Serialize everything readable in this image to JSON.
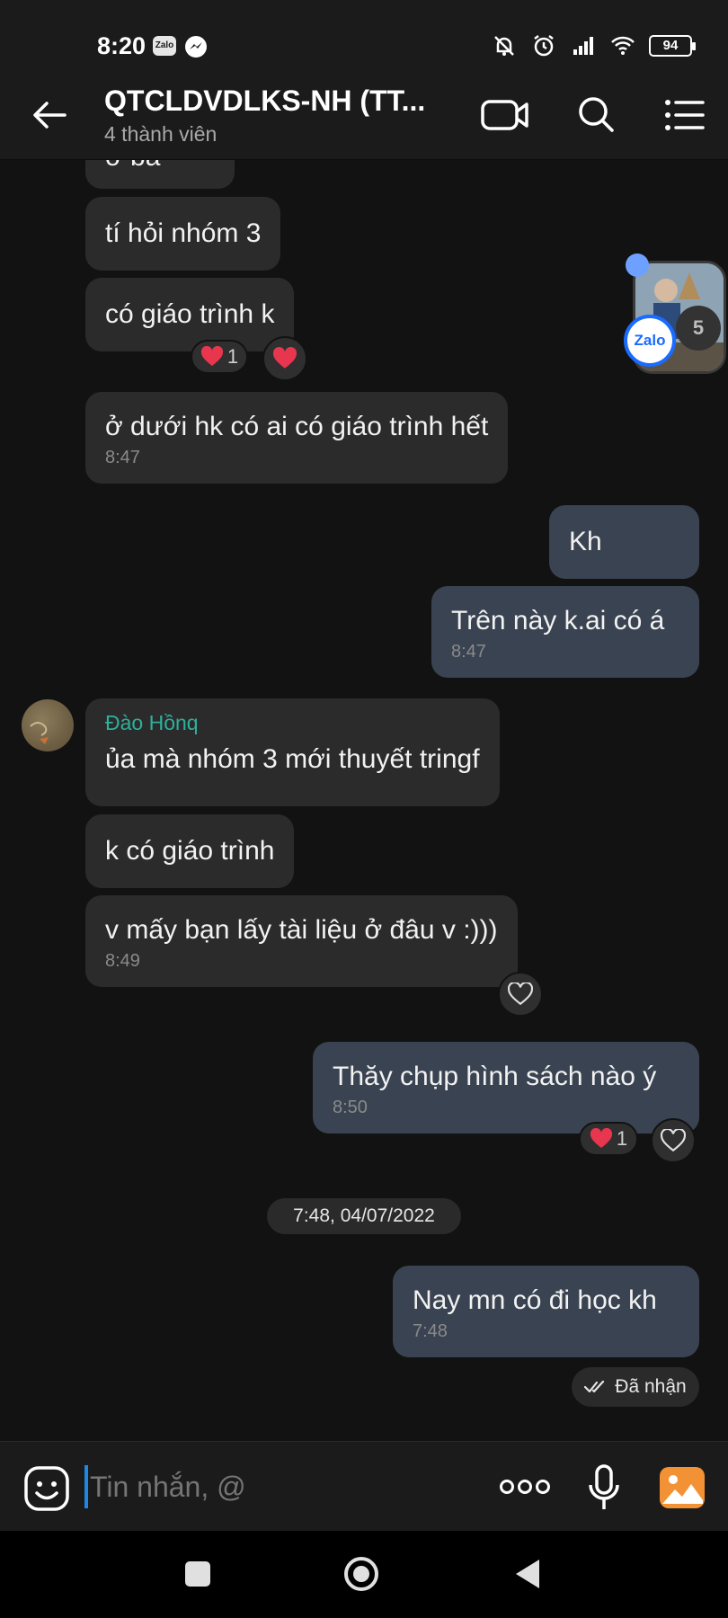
{
  "status_bar": {
    "time": "8:20",
    "zalo_label": "Zalo",
    "battery": "94"
  },
  "header": {
    "title": "QTCLDVDLKS-NH (TT...",
    "subtitle": "4 thành viên"
  },
  "messages": {
    "partial": "ở bà",
    "m1": "tí hỏi nhóm 3",
    "m2": "có giáo trình k",
    "m2_react_count": "1",
    "m3": "ở dưới hk có ai có giáo trình hết",
    "m3_time": "8:47",
    "o1": "Kh",
    "o2": "Trên này k.ai có á",
    "o2_time": "8:47",
    "sender": "Đào Hồnq",
    "m4": "ủa mà nhóm 3 mới thuyết tringf",
    "m5": "k có giáo trình",
    "m6": "v mấy bạn lấy tài liệu ở đâu v :)))",
    "m6_time": "8:49",
    "o3": "Thăy chụp hình sách nào ý",
    "o3_time": "8:50",
    "o3_react_count": "1",
    "date_divider": "7:48, 04/07/2022",
    "o4": "Nay mn có đi học kh",
    "o4_time": "7:48",
    "o4_status": "Đã nhận"
  },
  "floating_bubble": {
    "app": "Zalo",
    "count": "5"
  },
  "input": {
    "placeholder": "Tin nhắn, @"
  },
  "colors": {
    "background": "#121212",
    "incoming_bubble": "#2b2b2b",
    "outgoing_bubble": "#3a4351",
    "sender_name": "#2eb09b",
    "heart": "#e8364f",
    "accent": "#1e88e5"
  },
  "icons": [
    "back-arrow-icon",
    "video-call-icon",
    "search-icon",
    "menu-list-icon",
    "heart-icon",
    "emoji-icon",
    "more-icon",
    "microphone-icon",
    "gallery-icon",
    "double-check-icon"
  ]
}
